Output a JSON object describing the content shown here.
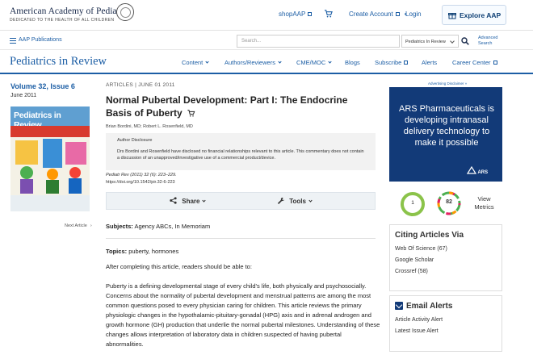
{
  "header": {
    "org_name": "American Academy of Pediatrics",
    "org_tagline": "DEDICATED TO THE HEALTH OF ALL CHILDREN",
    "shop": "shopAAP",
    "create_account": "Create Account",
    "login": "Login",
    "explore": "Explore AAP"
  },
  "subbar": {
    "publications": "AAP Publications",
    "search_placeholder": "Search...",
    "search_scope": "Pediatrics In Review",
    "advanced_search": "Advanced Search"
  },
  "nav": {
    "journal_title": "Pediatrics in Review",
    "items": [
      "Content",
      "Authors/Reviewers",
      "CME/MOC",
      "Blogs",
      "Subscribe",
      "Alerts",
      "Career Center"
    ]
  },
  "issue": {
    "volume": "Volume 32, Issue 6",
    "date": "June 2011",
    "cover_title": "Pediatrics in Review",
    "next_article": "Next Article"
  },
  "article": {
    "category": "ARTICLES | JUNE 01 2011",
    "title": "Normal Pubertal Development: Part I: The Endocrine Basis of Puberty",
    "authors": "Brian Bordini, MD; Robert L. Rosenfield, MD",
    "disclosure_heading": "Author Disclosure",
    "disclosure_text": "Drs Bordini and Rosenfield have disclosed no financial relationships relevant to this article. This commentary does not contain a discussion of an unapproved/investigative use of a commercial product/device.",
    "citation": "Pediatr Rev (2011) 32 (6): 223–229.",
    "doi": "https://doi.org/10.1542/pir.32-6-223",
    "share": "Share",
    "tools": "Tools",
    "subjects_label": "Subjects:",
    "subjects": "Agency ABCs, In Memoriam",
    "topics_label": "Topics:",
    "topics": "puberty, hormones",
    "intro": "After completing this article, readers should be able to:",
    "paragraph": "Puberty is a defining developmental stage of every child's life, both physically and psychosocially. Concerns about the normality of pubertal development and menstrual patterns are among the most common questions posed to every physician caring for children. This article reviews the primary physiologic changes in the hypothalamic-pituitary-gonadal (HPG) axis and in adrenal androgen and growth hormone (GH) production that underlie the normal pubertal milestones. Understanding of these changes allows interpretation of laboratory data in children suspected of having pubertal abnormalities."
  },
  "sidebar": {
    "ad_label": "Advertising Disclaimer »",
    "ad_text": "ARS Pharmaceuticals is developing intranasal delivery technology to make it possible",
    "ad_logo": "ARS",
    "altmetric_score": "1",
    "dimensions_score": "82",
    "view_metrics": "View Metrics",
    "citing_heading": "Citing Articles Via",
    "citing_items": [
      "Web Of Science (67)",
      "Google Scholar",
      "Crossref (58)"
    ],
    "alerts_heading": "Email Alerts",
    "alert_items": [
      "Article Activity Alert",
      "Latest Issue Alert"
    ]
  },
  "colors": {
    "brand_blue": "#1c5ea5",
    "ad_navy": "#123a78",
    "altmetric_green": "#8bc34a"
  }
}
